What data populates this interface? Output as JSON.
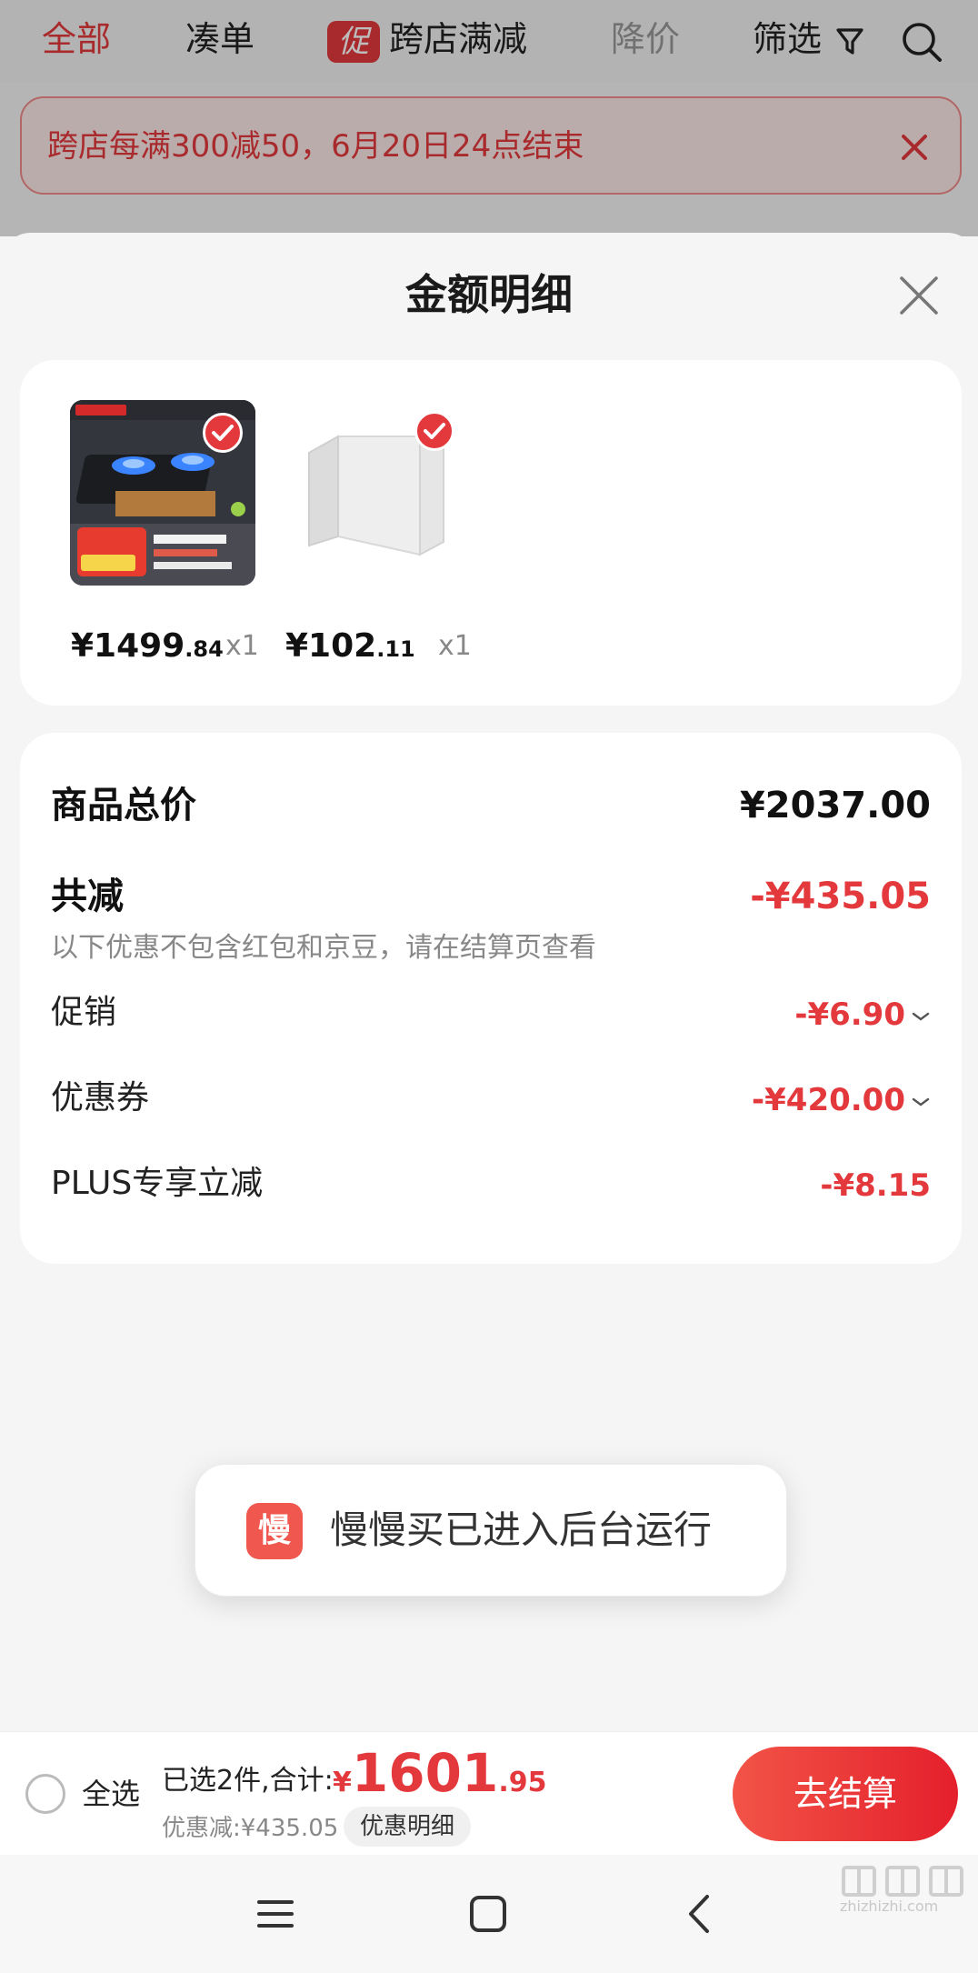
{
  "topbar": {
    "tabs": [
      {
        "label": "全部"
      },
      {
        "label": "凑单"
      },
      {
        "label": "跨店满减",
        "tag": "促"
      },
      {
        "label": "降价"
      },
      {
        "label": "筛选"
      }
    ]
  },
  "banner": {
    "text": "跨店每满300减50，6月20日24点结束"
  },
  "sheet": {
    "title": "金额明细"
  },
  "products": [
    {
      "price_int": "¥1499",
      "price_dec": ".84",
      "qty": "x1",
      "image_icon": "gas-stove-product-image"
    },
    {
      "price_int": "¥102",
      "price_dec": ".11",
      "qty": "x1",
      "image_icon": "cabinet-panel-product-image"
    }
  ],
  "summary": {
    "total_label": "商品总价",
    "total_value": "¥2037.00",
    "reduce_label": "共减",
    "reduce_value": "-¥435.05",
    "hint": "以下优惠不包含红包和京豆，请在结算页查看",
    "items": [
      {
        "label": "促销",
        "value": "-¥6.90",
        "expandable": true
      },
      {
        "label": "优惠券",
        "value": "-¥420.00",
        "expandable": true
      },
      {
        "label": "PLUS专享立减",
        "value": "-¥8.15",
        "expandable": false
      }
    ]
  },
  "toast": {
    "icon_text": "慢",
    "text": "慢慢买已进入后台运行"
  },
  "bottom_bar": {
    "select_all": "全选",
    "selected_text": "已选2件,合计:",
    "total_currency": "¥",
    "total_int": "1601",
    "total_dec": ".95",
    "discount_text": "优惠减:¥435.05",
    "detail_chip": "优惠明细",
    "checkout": "去结算"
  },
  "watermark": {
    "text": "zhizhizhi.com"
  },
  "colors": {
    "accent": "#e4393c",
    "background": "#f5f5f5"
  }
}
